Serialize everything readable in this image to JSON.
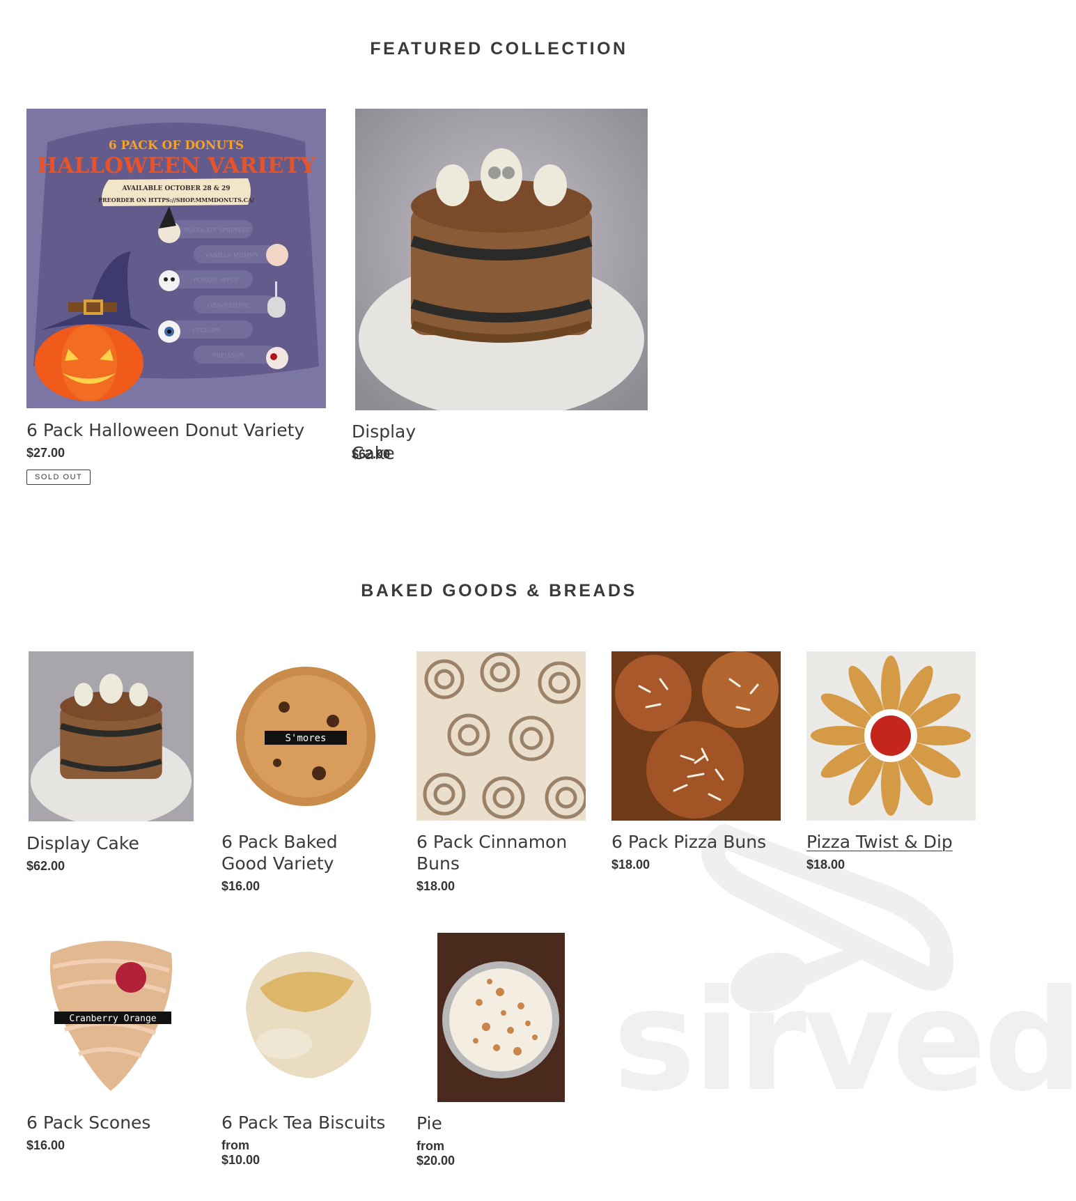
{
  "featured": {
    "heading": "FEATURED COLLECTION",
    "products": [
      {
        "title": "6 Pack Halloween Donut Variety",
        "price": "$27.00",
        "badge": "SOLD OUT"
      },
      {
        "title": "Display Cake",
        "price": "$62.00"
      }
    ],
    "flyer": {
      "line1": "6 PACK OF DONUTS",
      "line2": "HALLOWEEN VARIETY",
      "line3": "AVAILABLE OCTOBER 28 & 29",
      "line4": "PREORDER ON HTTPS://SHOP.MMMDONUTS.CA/",
      "flavors": [
        "CHOCOLATE SPRINKLE",
        "VANILLA MUMMY",
        "POISON APPLE",
        "GRAVESTONE",
        "CYCLOPS",
        "PREJASON"
      ]
    }
  },
  "baked": {
    "heading": "BAKED GOODS & BREADS",
    "products": [
      {
        "title": "Display Cake",
        "price": "$62.00"
      },
      {
        "title": "6 Pack Baked Good Variety",
        "price": "$16.00",
        "image_label": "S'mores"
      },
      {
        "title": "6 Pack Cinnamon Buns",
        "price": "$18.00"
      },
      {
        "title": "6 Pack Pizza Buns",
        "price": "$18.00"
      },
      {
        "title": "Pizza Twist & Dip",
        "price": "$18.00"
      },
      {
        "title": "6 Pack Scones",
        "price": "$16.00",
        "image_label": "Cranberry Orange"
      },
      {
        "title": "6 Pack Tea Biscuits",
        "price": "from $10.00"
      },
      {
        "title": "Pie",
        "price": "from $20.00"
      }
    ]
  },
  "watermark": {
    "text": "sirved"
  },
  "colors": {
    "flyer_bg": "#625b8c",
    "flyer_title": "#e8542a",
    "text": "#3a3a3a"
  }
}
